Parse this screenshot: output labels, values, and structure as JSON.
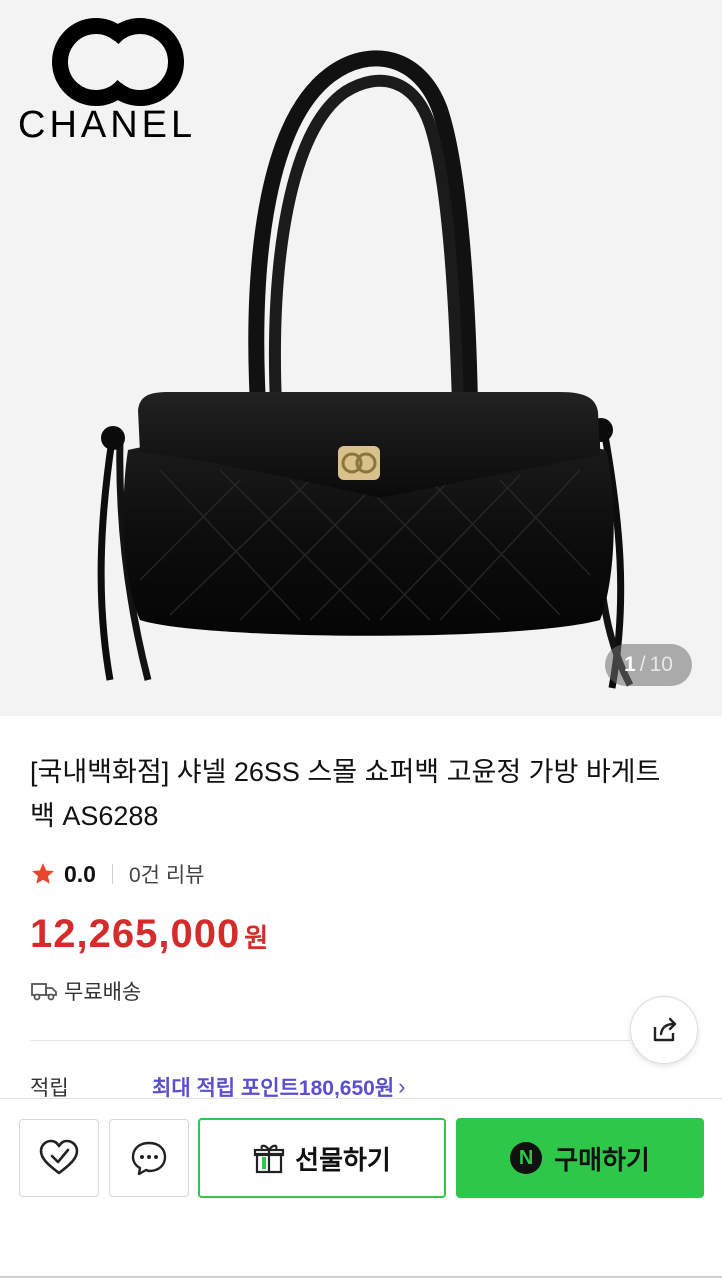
{
  "brand": {
    "name": "CHANEL"
  },
  "gallery": {
    "current": "1",
    "separator": "/",
    "total": "10"
  },
  "product": {
    "title": "[국내백화점] 샤넬 26SS 스몰 쇼퍼백 고윤정 가방 바게트백 AS6288",
    "rating": "0.0",
    "review_count": "0건 리뷰",
    "price": "12,265,000",
    "currency": "원",
    "shipping": "무료배송"
  },
  "points": {
    "label": "적립",
    "text": "최대 적립 포인트 ",
    "amount": "180,650원"
  },
  "actions": {
    "gift_label": "선물하기",
    "buy_label": "구매하기",
    "npay_mark": "N"
  },
  "icons": {
    "wishlist": "heart-check-icon",
    "chat": "chat-bubble-icon",
    "share": "share-icon",
    "gift": "gift-icon",
    "truck": "truck-icon",
    "star": "star-icon"
  },
  "colors": {
    "price": "#d52b2b",
    "points": "#5a4fcf",
    "accent_green": "#2ec74a"
  }
}
